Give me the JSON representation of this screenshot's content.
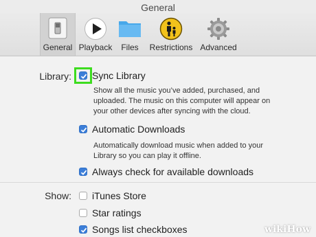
{
  "window": {
    "title": "General"
  },
  "toolbar": {
    "tabs": [
      {
        "label": "General",
        "icon": "general-switch-icon",
        "active": true
      },
      {
        "label": "Playback",
        "icon": "play-icon",
        "active": false
      },
      {
        "label": "Files",
        "icon": "folder-icon",
        "active": false
      },
      {
        "label": "Restrictions",
        "icon": "parental-restrictions-icon",
        "active": false
      },
      {
        "label": "Advanced",
        "icon": "gear-icon",
        "active": false
      }
    ]
  },
  "library": {
    "label": "Library:",
    "sync": {
      "label": "Sync Library",
      "checked": true,
      "description_lines": [
        "Show all the music you’ve added, purchased, and",
        "uploaded. The music on this computer will appear on",
        "your other devices after syncing with the cloud."
      ]
    },
    "auto_downloads": {
      "label": "Automatic Downloads",
      "checked": true,
      "description_lines": [
        "Automatically download music when added to your",
        "Library so you can play it offline."
      ]
    },
    "check_downloads": {
      "label": "Always check for available downloads",
      "checked": true
    }
  },
  "show": {
    "label": "Show:",
    "itunes_store": {
      "label": "iTunes Store",
      "checked": false
    },
    "star_ratings": {
      "label": "Star ratings",
      "checked": false
    },
    "songs_checkboxes": {
      "label": "Songs list checkboxes",
      "checked": true
    }
  },
  "colors": {
    "checkbox_on": "#3c7ed8",
    "highlight": "#3ddc1f"
  },
  "watermark": {
    "brand": "wikiHow"
  }
}
